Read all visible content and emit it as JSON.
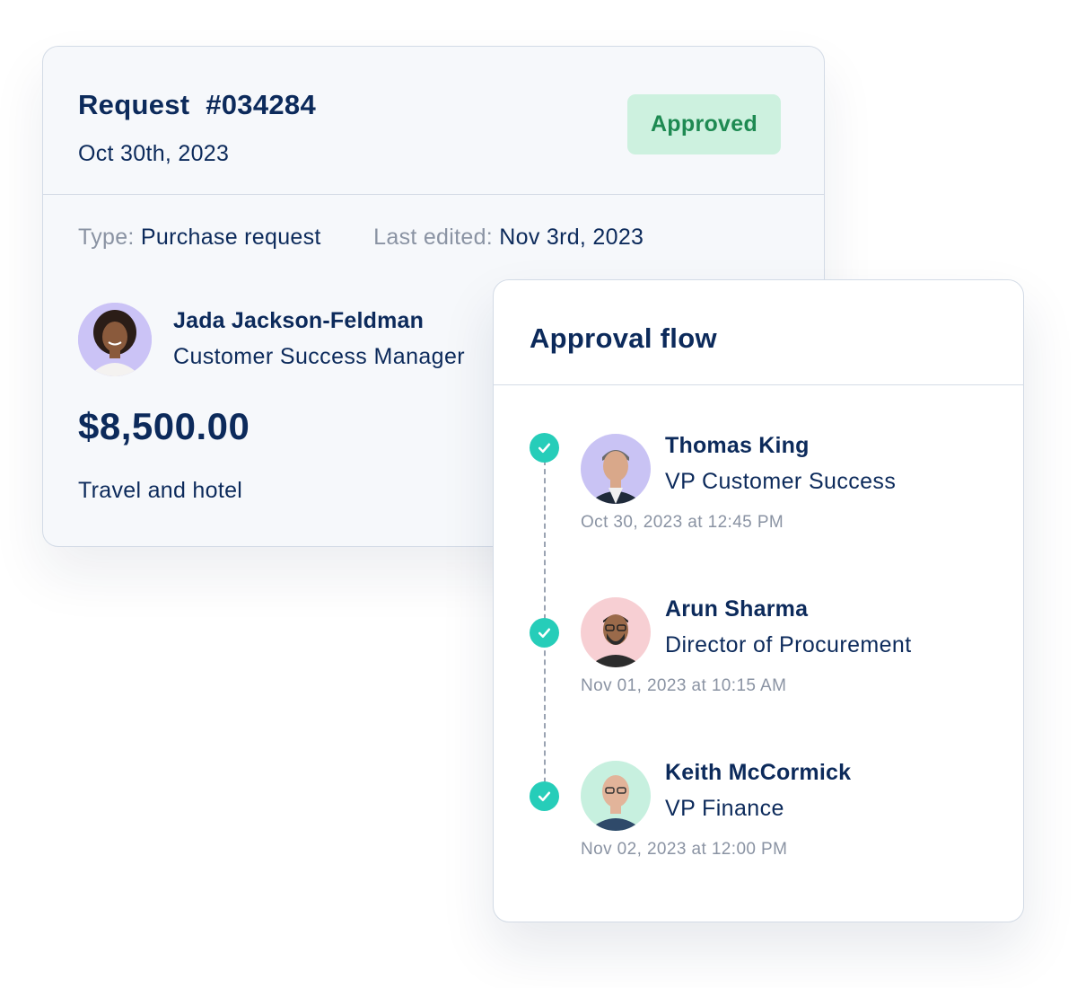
{
  "request": {
    "title": "Request  #034284",
    "date": "Oct 30th, 2023",
    "status": "Approved",
    "type_label": "Type:",
    "type_value": "Purchase request",
    "edited_label": "Last edited:",
    "edited_value": "Nov 3rd, 2023",
    "requester": {
      "name": "Jada Jackson-Feldman",
      "role": "Customer Success Manager",
      "avatar_bg": "#cbc3f6"
    },
    "amount": "$8,500.00",
    "description": "Travel and hotel"
  },
  "approval_flow": {
    "title": "Approval flow",
    "steps": [
      {
        "name": "Thomas King",
        "role": "VP Customer Success",
        "time": "Oct 30, 2023 at 12:45 PM",
        "status": "approved",
        "avatar_bg": "#c9c3f4"
      },
      {
        "name": "Arun Sharma",
        "role": "Director of Procurement",
        "time": "Nov 01, 2023 at 10:15 AM",
        "status": "approved",
        "avatar_bg": "#f7cfd3"
      },
      {
        "name": "Keith McCormick",
        "role": "VP Finance",
        "time": "Nov 02, 2023 at 12:00 PM",
        "status": "approved",
        "avatar_bg": "#c7f0df"
      }
    ]
  },
  "colors": {
    "text_primary": "#0c2a5b",
    "text_muted": "#8a93a3",
    "approved_badge_bg": "#cdf1df",
    "approved_badge_text": "#1e8a52",
    "check_accent": "#26cdb9"
  },
  "icons": {
    "check": "check-icon"
  }
}
